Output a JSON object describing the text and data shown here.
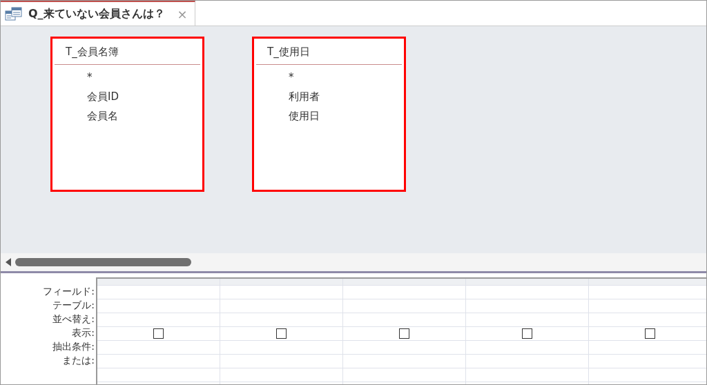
{
  "tab": {
    "title": "Q_来ていない会員さんは？",
    "close": "×",
    "selected": true
  },
  "tables": [
    {
      "name": "T_会員名簿",
      "highlighted": true,
      "fields": [
        "*",
        "会員ID",
        "会員名"
      ]
    },
    {
      "name": "T_使用日",
      "highlighted": true,
      "fields": [
        "*",
        "利用者",
        "使用日"
      ]
    }
  ],
  "grid": {
    "row_labels": [
      "フィールド:",
      "テーブル:",
      "並べ替え:",
      "表示:",
      "抽出条件:",
      "または:"
    ],
    "columns": [
      {
        "show": false
      },
      {
        "show": false
      },
      {
        "show": false
      },
      {
        "show": false
      },
      {
        "show": false
      }
    ]
  }
}
